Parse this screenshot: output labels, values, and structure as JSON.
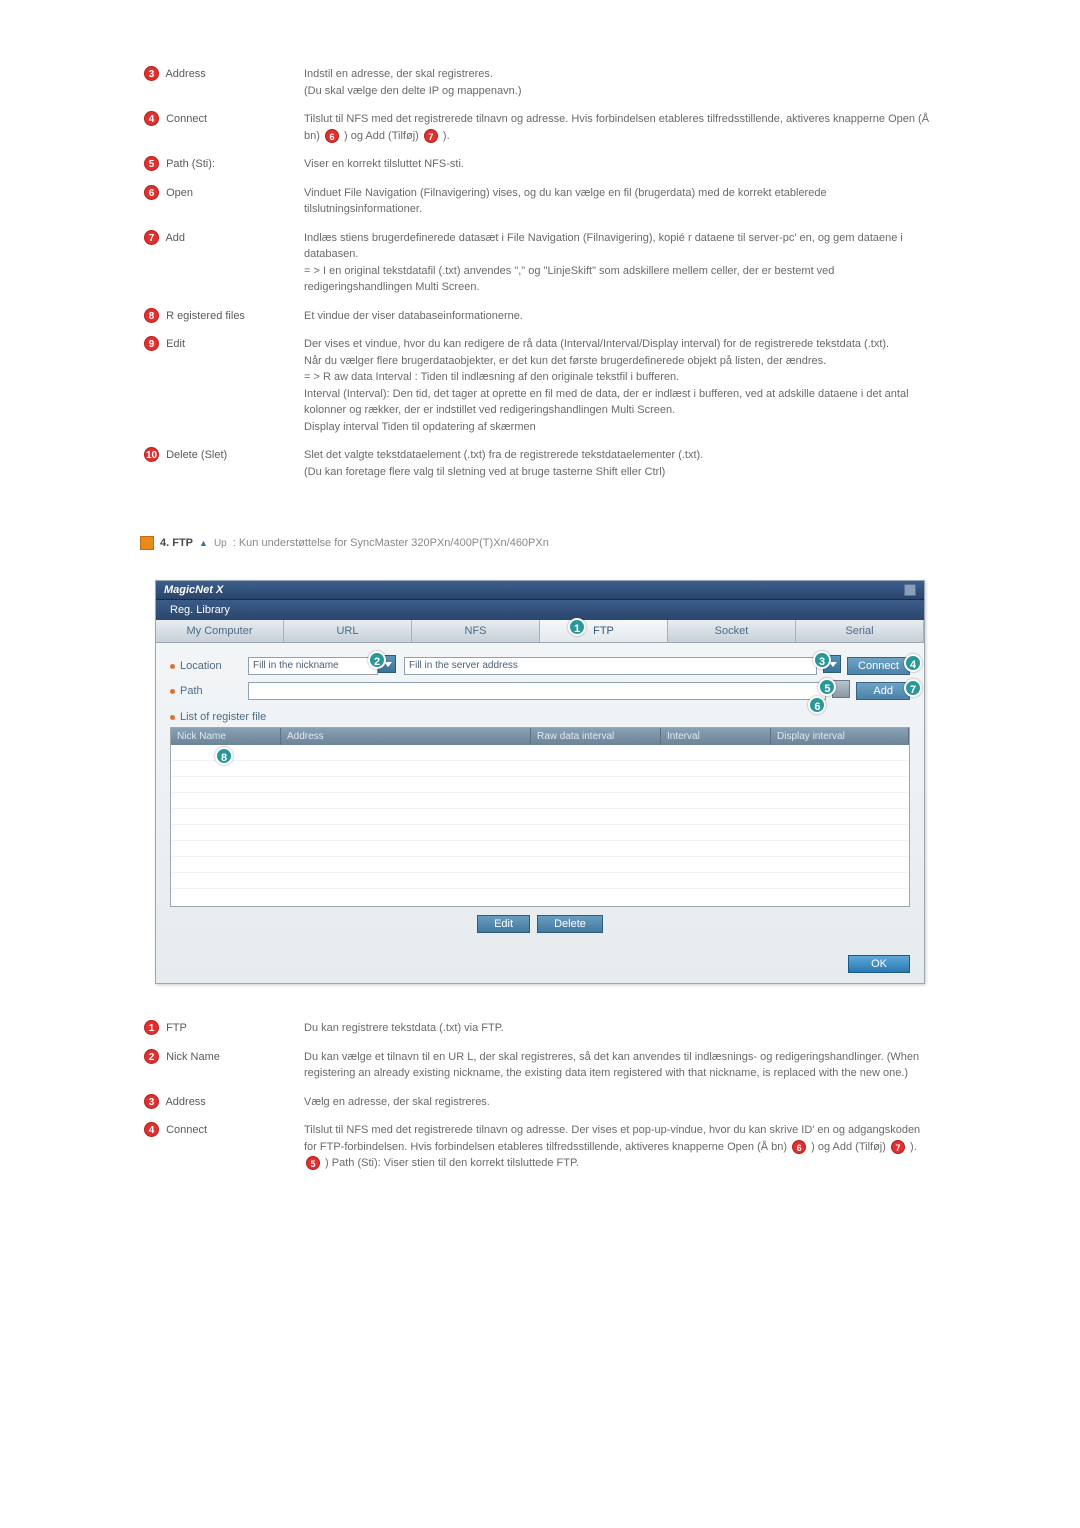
{
  "defs_top": [
    {
      "num": "3",
      "cls": "nc-red",
      "label": "Address",
      "desc": "Indstil en adresse, der skal registreres.\n(Du skal vælge den delte IP og mappenavn.)"
    },
    {
      "num": "4",
      "cls": "nc-red",
      "label": "Connect",
      "desc": "Tilslut til NFS med det registrerede tilnavn og adresse. Hvis forbindelsen etableres tilfredsstillende, aktiveres knapperne Open (Å bn) {6:nc-red} ) og Add (Tilføj) {7:nc-red} )."
    },
    {
      "num": "5",
      "cls": "nc-red",
      "label": "Path (Sti):",
      "desc": "Viser en korrekt tilsluttet NFS-sti."
    },
    {
      "num": "6",
      "cls": "nc-red",
      "label": "Open",
      "desc": "Vinduet File Navigation (Filnavigering) vises, og du kan vælge en fil (brugerdata) med de korrekt etablerede tilslutningsinformationer."
    },
    {
      "num": "7",
      "cls": "nc-red",
      "label": "Add",
      "desc": "Indlæs stiens brugerdefinerede datasæt i File Navigation (Filnavigering), kopié r dataene til server-pc' en, og gem dataene i databasen.\n= > I en original tekstdatafil (.txt) anvendes \",\" og \"LinjeSkift\" som adskillere mellem celler, der er bestemt ved redigeringshandlingen Multi Screen."
    },
    {
      "num": "8",
      "cls": "nc-red",
      "label": "R egistered files",
      "desc": "Et vindue der viser databaseinformationerne."
    },
    {
      "num": "9",
      "cls": "nc-red",
      "label": "Edit",
      "desc": "Der vises et vindue, hvor du kan redigere de rå data (Interval/Interval/Display interval) for de registrerede tekstdata (.txt).\nNår du vælger flere brugerdataobjekter, er det kun det første brugerdefinerede objekt på listen, der ændres.\n= > R aw data Interval : Tiden til indlæsning af den originale tekstfil i bufferen.\nInterval (Interval): Den tid, det tager at oprette en fil med de data, der er indlæst i bufferen, ved at adskille dataene i det antal kolonner og rækker, der er indstillet ved redigeringshandlingen Multi Screen.\nDisplay interval Tiden til opdatering af skærmen"
    },
    {
      "num": "10",
      "cls": "nc-red",
      "label": "Delete (Slet)",
      "desc": "Slet det valgte tekstdataelement (.txt) fra de registrerede tekstdataelementer (.txt).\n(Du kan foretage flere valg til sletning ved at bruge tasterne Shift eller Ctrl)"
    }
  ],
  "section": {
    "title": "4. FTP",
    "up": "Up",
    "note": ": Kun understøttelse for SyncMaster 320PXn/400P(T)Xn/460PXn"
  },
  "dialog": {
    "title": "MagicNet X",
    "tab": "Reg. Library",
    "subtabs": [
      "My Computer",
      "URL",
      "NFS",
      "FTP",
      "Socket",
      "Serial"
    ],
    "selected_subtab": 3,
    "location_label": "Location",
    "path_label": "Path",
    "nick_placeholder": "Fill in the nickname",
    "addr_placeholder": "Fill in the server address",
    "connect_btn": "Connect",
    "add_btn": "Add",
    "list_label": "List of register file",
    "cols": [
      "Nick Name",
      "Address",
      "Raw data interval",
      "Interval",
      "Display interval"
    ],
    "edit_btn": "Edit",
    "delete_btn": "Delete",
    "ok_btn": "OK"
  },
  "defs_bottom": [
    {
      "num": "1",
      "cls": "nc-red",
      "label": "FTP",
      "desc": "Du kan registrere tekstdata (.txt) via FTP."
    },
    {
      "num": "2",
      "cls": "nc-red",
      "label": "Nick Name",
      "desc": "Du kan vælge et tilnavn til en UR L, der skal registreres, så det kan anvendes til indlæsnings- og redigeringshandlinger. (When registering an already existing nickname, the existing data item registered with that nickname, is replaced with the new one.)"
    },
    {
      "num": "3",
      "cls": "nc-red",
      "label": "Address",
      "desc": "Vælg en adresse, der skal registreres."
    },
    {
      "num": "4",
      "cls": "nc-red",
      "label": "Connect",
      "desc": "Tilslut til NFS med det registrerede tilnavn og adresse. Der vises et pop-up-vindue, hvor du kan skrive ID' en og adgangskoden for FTP-forbindelsen. Hvis forbindelsen etableres tilfredsstillende, aktiveres knapperne Open (Å bn) {6:nc-red} ) og Add (Tilføj) {7:nc-red} ). {5:nc-red} ) Path (Sti): Viser stien til den korrekt tilsluttede FTP."
    }
  ]
}
